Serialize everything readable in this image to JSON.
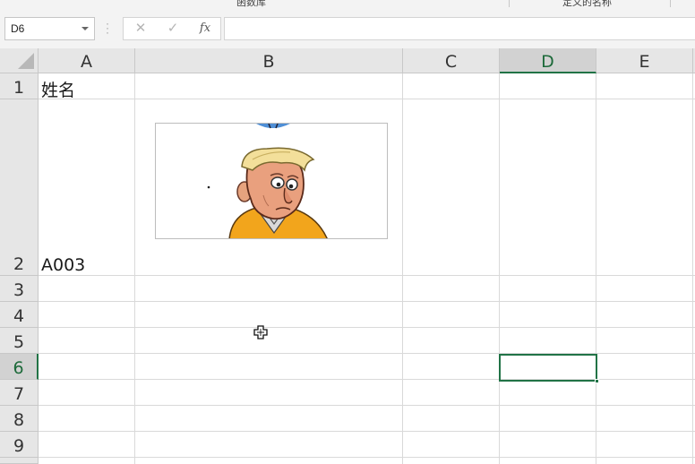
{
  "ribbon": {
    "left_cut_text": "函数库",
    "right_cut_text": "定义的名称"
  },
  "formula_bar": {
    "name_box": "D6",
    "cancel_icon": "✕",
    "enter_icon": "✓",
    "fx_label": "fx",
    "formula": ""
  },
  "columns": [
    {
      "label": "A",
      "selected": false
    },
    {
      "label": "B",
      "selected": false
    },
    {
      "label": "C",
      "selected": false
    },
    {
      "label": "D",
      "selected": true
    },
    {
      "label": "E",
      "selected": false
    }
  ],
  "rows": [
    {
      "label": "1",
      "selected": false
    },
    {
      "label": "2",
      "selected": false
    },
    {
      "label": "3",
      "selected": false
    },
    {
      "label": "4",
      "selected": false
    },
    {
      "label": "5",
      "selected": false
    },
    {
      "label": "6",
      "selected": true
    },
    {
      "label": "7",
      "selected": false
    },
    {
      "label": "8",
      "selected": false
    },
    {
      "label": "9",
      "selected": false
    }
  ],
  "cells": {
    "A1": "姓名",
    "A2": "A003"
  },
  "active_cell": "D6",
  "picture": {
    "description_icon": "cartoon-face-icon"
  },
  "colors": {
    "accent": "#217346",
    "header_bg": "#e6e6e6",
    "grid_line": "#d9d9d9"
  }
}
